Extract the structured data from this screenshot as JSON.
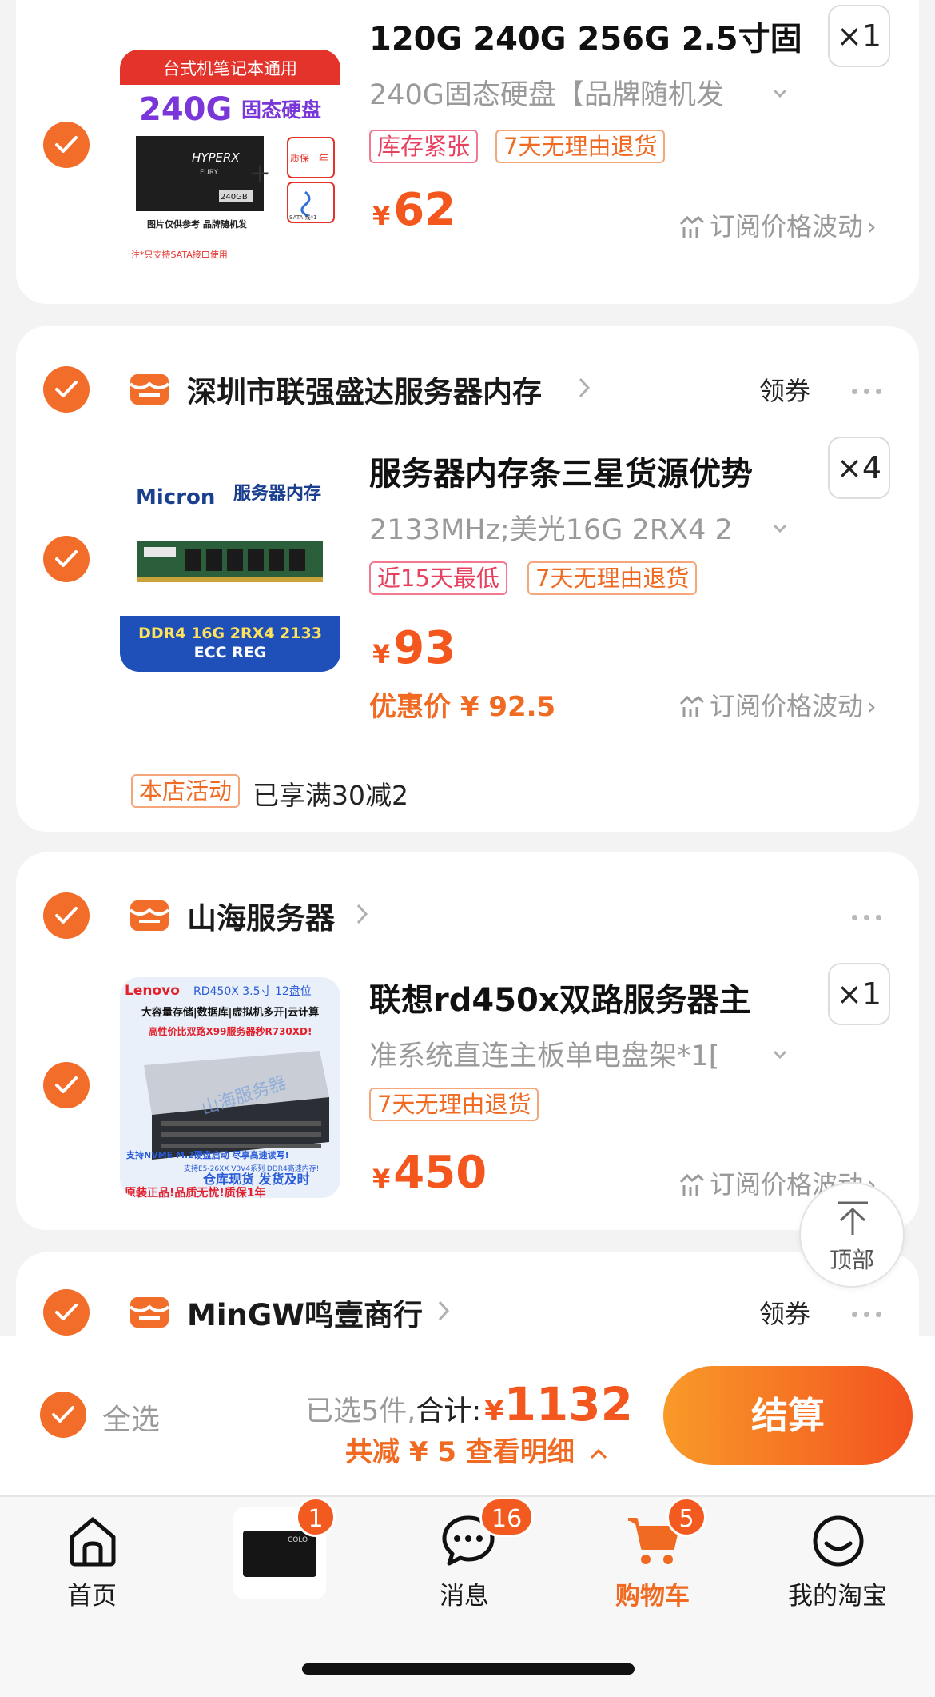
{
  "cards": [
    {
      "item": {
        "title": "120G 240G 256G 2.5寸固",
        "spec": "240G固态硬盘【品牌随机发",
        "qty": "×1",
        "tags": [
          "库存紧张",
          "7天无理由退货"
        ],
        "price_symbol": "¥",
        "price": "62",
        "track": "订阅价格波动",
        "image": {
          "banner": "台式机笔记本通用",
          "headline": "240G",
          "headline_sub": "固态硬盘",
          "drive_brand": "HYPERX",
          "drive_sub": "FURY",
          "drive_cap": "240GB",
          "warranty": "质保一年",
          "cable": "SATA 线*1",
          "note1": "图片仅供参考 品牌随机发",
          "note2": "注*只支持SATA接口使用"
        }
      }
    },
    {
      "shop": "深圳市联强盛达服务器内存",
      "coupon": "领券",
      "item": {
        "title": "服务器内存条三星货源优势",
        "spec": "2133MHz;美光16G 2RX4 2",
        "qty": "×4",
        "tags": [
          "近15天最低",
          "7天无理由退货"
        ],
        "price_symbol": "¥",
        "price": "93",
        "promo_price": "优惠价 ¥ 92.5",
        "track": "订阅价格波动",
        "image": {
          "brand": "Micron",
          "label": "服务器内存",
          "line1": "DDR4 16G 2RX4 2133",
          "line2": "ECC REG"
        }
      },
      "activity_tag": "本店活动",
      "activity_text": "已享满30减2"
    },
    {
      "shop": "山海服务器",
      "item": {
        "title": "联想rd450x双路服务器主",
        "spec": "准系统直连主板单电盘架*1[",
        "qty": "×1",
        "tags": [
          "7天无理由退货"
        ],
        "price_symbol": "¥",
        "price": "450",
        "track": "订阅价格波动",
        "image": {
          "brand": "Lenovo",
          "model": "RD450X 3.5寸 12盘位",
          "line1": "大容量存储|数据库|虚拟机多开|云计算",
          "line2": "高性价比双路X99服务器秒R730XD!",
          "watermark": "山海服务器",
          "line3": "支持NVME M.2硬盘启动 尽享高速读写!",
          "line4": "支持E5-26XX V3V4系列 DDR4高速内存!",
          "line5": "仓库现货 发货及时",
          "line6": "原装正品!品质无忧!质保1年"
        }
      }
    },
    {
      "shop": "MinGW鸣壹商行",
      "coupon": "领券"
    }
  ],
  "to_top": "顶部",
  "bottom": {
    "select_all": "全选",
    "selected_prefix": "已选5件",
    "total_label": "合计:",
    "total_symbol": "¥",
    "total": "1132",
    "discount": "共减 ¥ 5  查看明细",
    "checkout": "结算"
  },
  "tabs": [
    {
      "label": "首页",
      "icon": "home-icon"
    },
    {
      "label": "",
      "icon": "ssd-thumbnail",
      "badge": "1"
    },
    {
      "label": "消息",
      "icon": "message-icon",
      "badge": "16"
    },
    {
      "label": "购物车",
      "icon": "cart-icon",
      "badge": "5"
    },
    {
      "label": "我的淘宝",
      "icon": "smile-icon"
    }
  ],
  "colors": {
    "accent": "#f36d2a",
    "price": "#f3571d",
    "tag_red": "#e8405f",
    "tag_orange": "#f06a22",
    "checkout_start": "#f99a29",
    "checkout_end": "#f3531f"
  }
}
